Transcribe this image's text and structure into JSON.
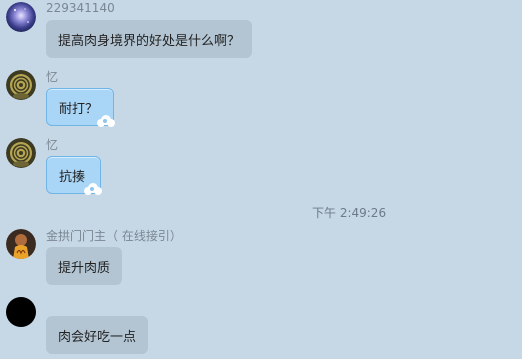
{
  "messages": [
    {
      "sender": "229341140",
      "text": "提高肉身境界的好处是什么啊？"
    },
    {
      "sender": "忆",
      "text": "耐打？"
    },
    {
      "sender": "忆",
      "text": "抗揍"
    },
    {
      "timestamp": "下午 2:49:26"
    },
    {
      "sender": "金拱门门主（ 在线接引）",
      "text": "提升肉质"
    },
    {
      "sender": "",
      "text": "肉会好吃一点"
    }
  ],
  "colors": {
    "background": "#c6d8e6",
    "bubble_gray": "#b3c5d3",
    "bubble_blue": "#a9d5f6",
    "name_text": "#7b8792"
  },
  "icons": [
    "galaxy-avatar",
    "swirl-avatar",
    "swirl-avatar",
    "golden-arches-avatar",
    "black-avatar",
    "cloud-decoration-icon"
  ]
}
